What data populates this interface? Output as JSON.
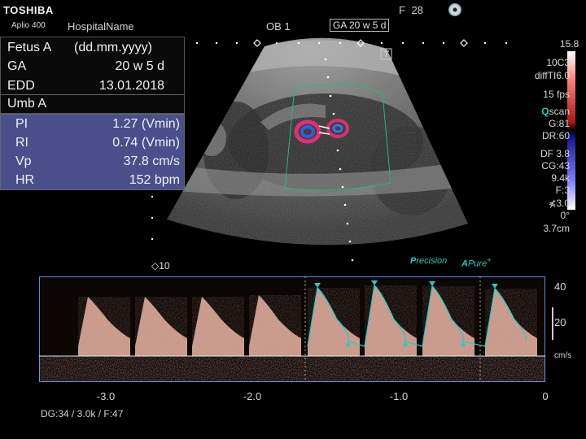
{
  "header": {
    "brand": "TOSHIBA",
    "model": "Aplio 400",
    "hospital": "HospitalName",
    "preset": "OB 1",
    "ga_box": "GA 20 w 5 d",
    "frame": "F 28",
    "disc_icon": "disc-icon"
  },
  "patient_panel": {
    "fetus_label": "Fetus A",
    "date_format": "(dd.mm.yyyy)",
    "ga_label": "GA",
    "ga_value": "20 w 5 d",
    "edd_label": "EDD",
    "edd_value": "13.01.2018",
    "vessel": "Umb A"
  },
  "measurements": [
    {
      "label": "PI",
      "value": "1.27 (Vmin)"
    },
    {
      "label": "RI",
      "value": "0.74 (Vmin)"
    },
    {
      "label": "Vp",
      "value": "37.8 cm/s"
    },
    {
      "label": "HR",
      "value": "152 bpm"
    }
  ],
  "params": {
    "probe": "10C3",
    "mode": "diffTI6.0",
    "fps": "15 fps",
    "qscan_q": "Q",
    "qscan_rest": "scan",
    "gain": "G:81",
    "dr": "DR:60",
    "df": "DF 3.8",
    "cg": "CG:43",
    "prf": "9.4k",
    "filter": "F:3",
    "angle_val": "3.0",
    "angle_deg": "0°",
    "depth": "3.7cm",
    "color_max": "15.8"
  },
  "image": {
    "depth_marker": "◇10",
    "precision_p": "P",
    "precision_rest": "recision",
    "apure_a": "A",
    "apure_rest": "Pure",
    "apure_plus": "+"
  },
  "doppler": {
    "scale_labels": [
      "40",
      "20"
    ],
    "unit": "cm/s",
    "time_labels": [
      "-3.0",
      "-2.0",
      "-1.0",
      "0"
    ],
    "time_values": [
      -3.0,
      -2.0,
      -1.0,
      0
    ],
    "footer": "DG:34  / 3.0k   / F:47"
  },
  "colors": {
    "panel_blue": "#4a4f8c",
    "trace_cyan": "#2fc7c7",
    "doppler_border": "#5a8ad8",
    "spectrum": "#f0b8a8"
  }
}
